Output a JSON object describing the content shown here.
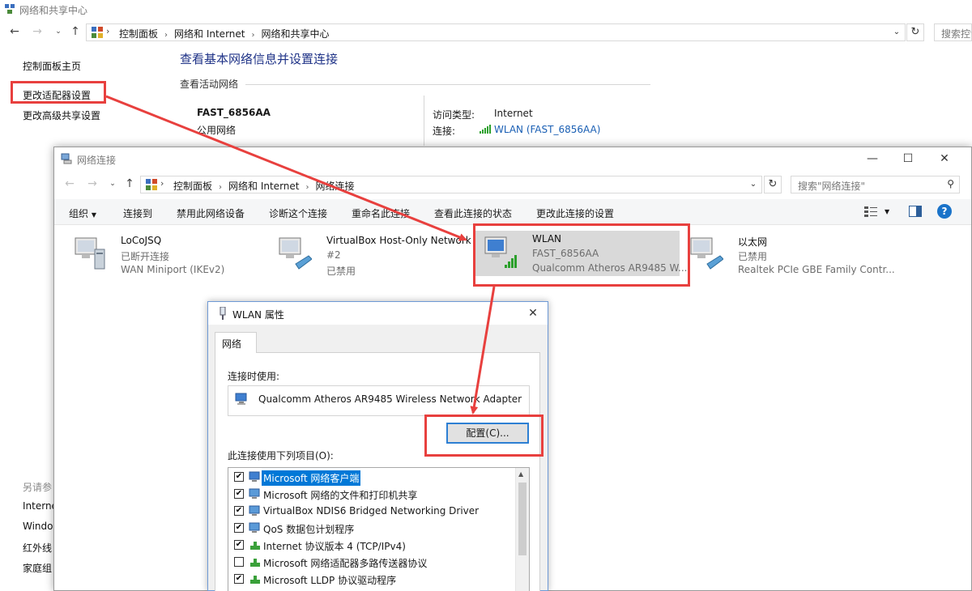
{
  "bg_window": {
    "title": "网络和共享中心",
    "breadcrumb": [
      "控制面板",
      "网络和 Internet",
      "网络和共享中心"
    ],
    "search_placeholder": "搜索控制",
    "left_links": [
      "控制面板主页",
      "更改适配器设置",
      "更改高级共享设置"
    ],
    "heading": "查看基本网络信息并设置连接",
    "section_label": "查看活动网络",
    "network_name": "FAST_6856AA",
    "network_type": "公用网络",
    "access_label": "访问类型:",
    "access_value": "Internet",
    "connection_label": "连接:",
    "connection_value": "WLAN (FAST_6856AA)",
    "see_also": [
      "另请参",
      "Interne",
      "Windo",
      "红外线",
      "家庭组"
    ]
  },
  "nc_window": {
    "title": "网络连接",
    "breadcrumb": [
      "控制面板",
      "网络和 Internet",
      "网络连接"
    ],
    "search_placeholder": "搜索\"网络连接\"",
    "toolbar": {
      "organize": "组织",
      "connect_to": "连接到",
      "disable": "禁用此网络设备",
      "diagnose": "诊断这个连接",
      "rename": "重命名此连接",
      "view_status": "查看此连接的状态",
      "change_settings": "更改此连接的设置"
    },
    "adapters": [
      {
        "name": "LoCoJSQ",
        "status": "已断开连接",
        "device": "WAN Miniport (IKEv2)"
      },
      {
        "name": "VirtualBox Host-Only Network",
        "name2": "#2",
        "status": "已禁用"
      },
      {
        "name": "WLAN",
        "status": "FAST_6856AA",
        "device": "Qualcomm Atheros AR9485 W..."
      },
      {
        "name": "以太网",
        "status": "已禁用",
        "device": "Realtek PCIe GBE Family Contr..."
      }
    ]
  },
  "dialog": {
    "title": "WLAN 属性",
    "tab": "网络",
    "connect_using_label": "连接时使用:",
    "adapter_name": "Qualcomm Atheros AR9485 Wireless Network Adapter",
    "configure_button": "配置(C)...",
    "items_label": "此连接使用下列项目(O):",
    "items": [
      {
        "label": "Microsoft 网络客户端",
        "checked": true
      },
      {
        "label": "Microsoft 网络的文件和打印机共享",
        "checked": true
      },
      {
        "label": "VirtualBox NDIS6 Bridged Networking Driver",
        "checked": true
      },
      {
        "label": "QoS 数据包计划程序",
        "checked": true
      },
      {
        "label": "Internet 协议版本 4 (TCP/IPv4)",
        "checked": true
      },
      {
        "label": "Microsoft 网络适配器多路传送器协议",
        "checked": false
      },
      {
        "label": "Microsoft LLDP 协议驱动程序",
        "checked": true
      }
    ]
  },
  "colors": {
    "annotation_red": "#e8403e",
    "heading_blue": "#1e3287",
    "selection_blue": "#0078d7"
  }
}
